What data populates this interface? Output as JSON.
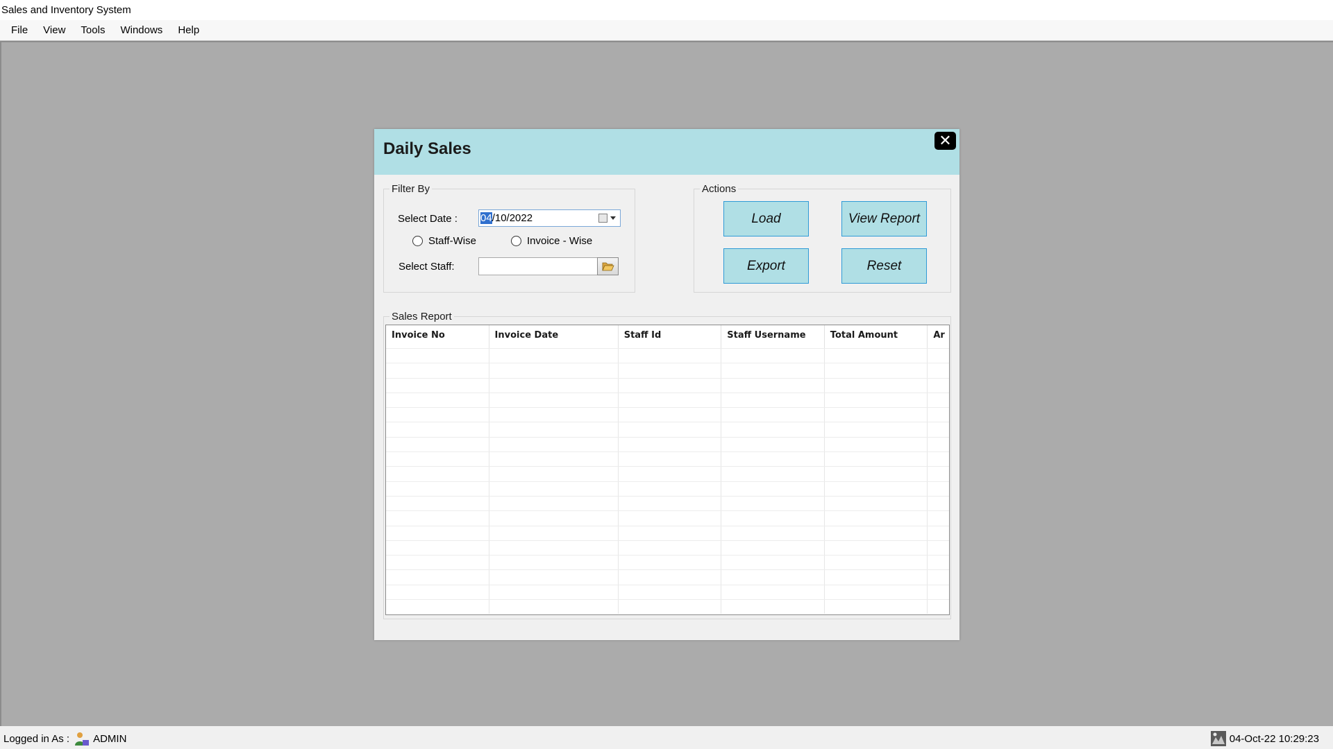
{
  "app": {
    "title": "Sales and Inventory System"
  },
  "menu": {
    "items": [
      "File",
      "View",
      "Tools",
      "Windows",
      "Help"
    ]
  },
  "dialog": {
    "title": "Daily Sales",
    "filter": {
      "legend": "Filter By",
      "date_label": "Select Date :",
      "date_value_day": "04",
      "date_value_rest": "/10/2022",
      "staff_wise_label": "Staff-Wise",
      "invoice_wise_label": "Invoice - Wise",
      "staff_label": "Select Staff:",
      "staff_value": ""
    },
    "actions": {
      "legend": "Actions",
      "load": "Load",
      "view_report": "View Report",
      "export": "Export",
      "reset": "Reset"
    },
    "report": {
      "legend": "Sales Report",
      "columns": [
        "Invoice No",
        "Invoice Date",
        "Staff Id",
        "Staff Username",
        "Total Amount",
        "Ar"
      ],
      "rows": []
    }
  },
  "status": {
    "logged_in_label": "Logged in As :",
    "user": "ADMIN",
    "datetime": "04-Oct-22 10:29:23"
  },
  "icons": {
    "close": "close-icon",
    "calendar": "calendar-icon",
    "folder": "folder-open-icon",
    "user": "user-icon",
    "clock": "clock-icon"
  }
}
